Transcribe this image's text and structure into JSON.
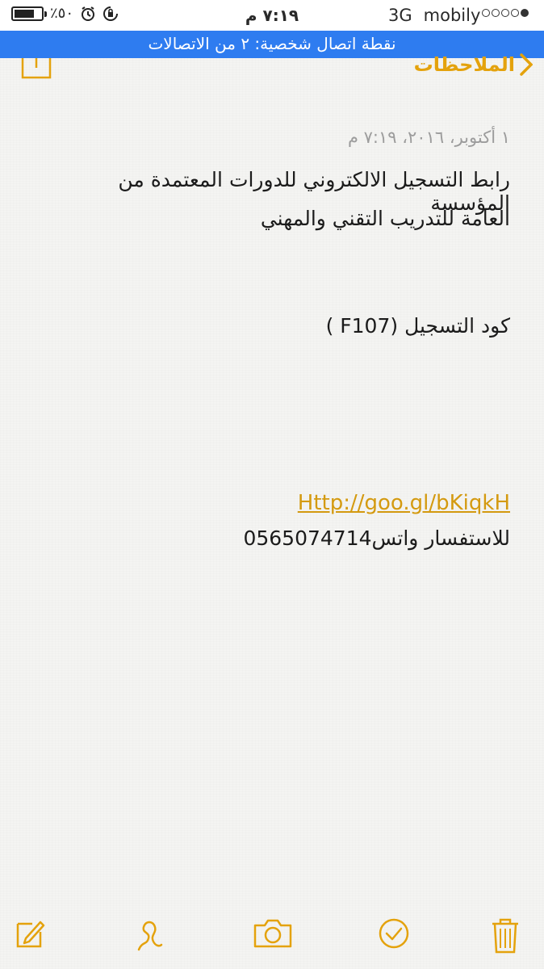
{
  "status_bar": {
    "carrier": "mobily",
    "network": "3G",
    "time": "٧:١٩ م",
    "battery_percent": "٪٥٠",
    "battery_level": 0.5
  },
  "hotspot_banner": "نقطة اتصال شخصية: ٢ من الاتصالات",
  "nav": {
    "back_label": "الملاحظات",
    "accent_color": "#e4a20c"
  },
  "note": {
    "date": "١ أكتوبر، ٢٠١٦، ٧:١٩ م",
    "line1": "رابط التسجيل الالكتروني للدورات المعتمدة من المؤسسة",
    "line2": "العامة للتدريب التقني والمهني",
    "line3": "كود التسجيل (F107 )",
    "link": "Http://goo.gl/bKiqkH",
    "line5": "للاستفسار واتس0565074714"
  },
  "toolbar": {
    "items": [
      "trash-icon",
      "checklist-icon",
      "camera-icon",
      "sketch-icon",
      "compose-icon"
    ]
  },
  "colors": {
    "hotspot_blue": "#2e7cf0",
    "accent": "#e4a20c",
    "link": "#d49a10"
  }
}
